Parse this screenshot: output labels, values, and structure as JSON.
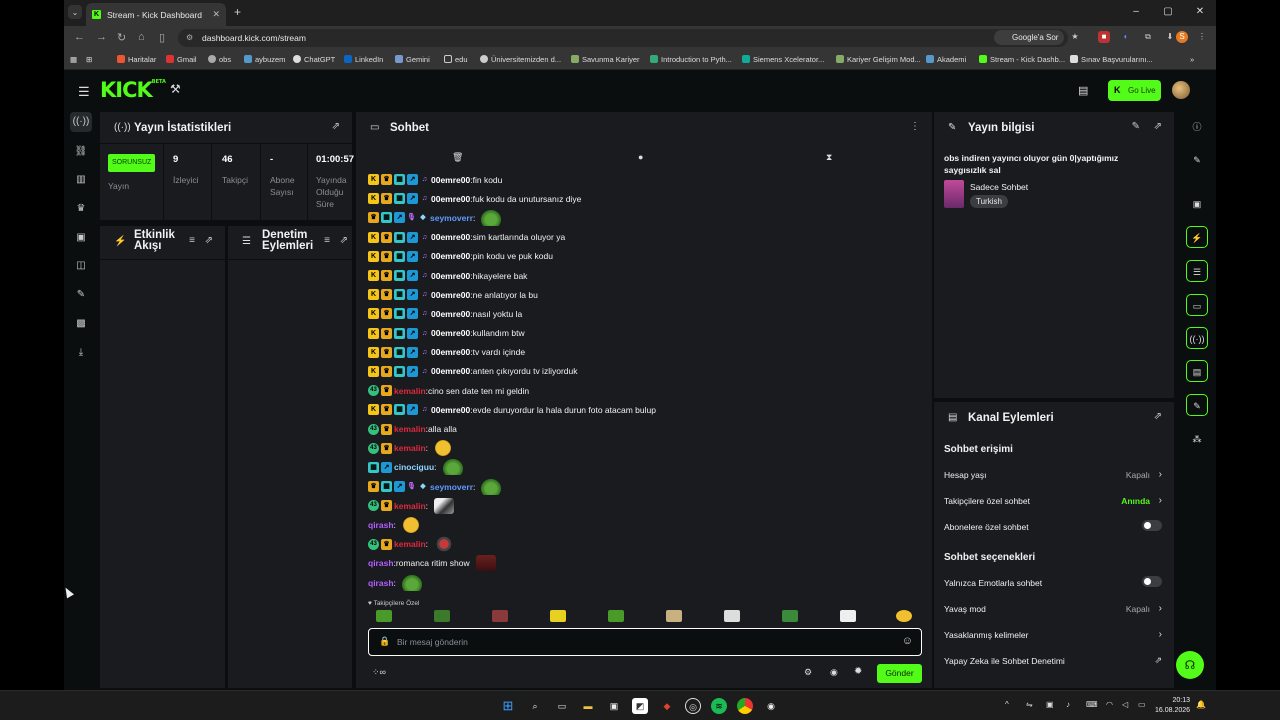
{
  "browser": {
    "tab_title": "Stream - Kick Dashboard",
    "url": "dashboard.kick.com/stream",
    "google_btn": "Google'a Sor",
    "bookmarks": [
      "Haritalar",
      "Gmail",
      "obs",
      "aybuzem",
      "ChatGPT",
      "LinkedIn",
      "Gemini",
      "edu",
      "Üniversitemizden d...",
      "Savunma Kariyer",
      "Introduction to Pyth...",
      "Siemens Xcelerator...",
      "Kariyer Gelişim Mod...",
      "Akademi",
      "Stream - Kick Dashb...",
      "Sınav Başvurularını..."
    ]
  },
  "header": {
    "logo": "KICK",
    "logo_sup": "BETA",
    "go_live": "Go Live"
  },
  "stats": {
    "title": "Yayın İstatistikleri",
    "badge": "SORUNSUZ",
    "badge_label": "Yayın",
    "viewers": "9",
    "viewers_label": "İzleyici",
    "followers": "46",
    "followers_label": "Takipçi",
    "subs": "-",
    "subs_label": "Abone Sayısı",
    "duration": "01:00:57",
    "duration_label": "Yayında Olduğu Süre"
  },
  "activity": {
    "title": "Etkinlik Akışı"
  },
  "moderation": {
    "title": "Denetim Eylemleri"
  },
  "chat": {
    "title": "Sohbet",
    "pinned_label": "Takipçilere Özel",
    "placeholder": "Bir mesaj gönderin",
    "send": "Gönder",
    "messages": [
      {
        "badges": [
          "k",
          "crown",
          "gift",
          "sub",
          "mus"
        ],
        "user": "00emre00",
        "color": "green",
        "text": "fin kodu"
      },
      {
        "badges": [
          "k",
          "crown",
          "gift",
          "sub",
          "mus"
        ],
        "user": "00emre00",
        "color": "green",
        "text": "fuk kodu da unutursanız diye"
      },
      {
        "badges": [
          "crown",
          "gift",
          "sub",
          "mic",
          "gem"
        ],
        "user": "seymoverr",
        "color": "blue",
        "text": "",
        "emote": "frog"
      },
      {
        "badges": [
          "k",
          "crown",
          "gift",
          "sub",
          "mus"
        ],
        "user": "00emre00",
        "color": "green",
        "text": "sim kartlarında oluyor ya"
      },
      {
        "badges": [
          "k",
          "crown",
          "gift",
          "sub",
          "mus"
        ],
        "user": "00emre00",
        "color": "green",
        "text": "pin kodu ve puk kodu"
      },
      {
        "badges": [
          "k",
          "crown",
          "gift",
          "sub",
          "mus"
        ],
        "user": "00emre00",
        "color": "green",
        "text": "hikayelere bak"
      },
      {
        "badges": [
          "k",
          "crown",
          "gift",
          "sub",
          "mus"
        ],
        "user": "00emre00",
        "color": "green",
        "text": "ne anlatıyor la bu"
      },
      {
        "badges": [
          "k",
          "crown",
          "gift",
          "sub",
          "mus"
        ],
        "user": "00emre00",
        "color": "green",
        "text": "nasıl yoktu la"
      },
      {
        "badges": [
          "k",
          "crown",
          "gift",
          "sub",
          "mus"
        ],
        "user": "00emre00",
        "color": "green",
        "text": "kullandım btw"
      },
      {
        "badges": [
          "k",
          "crown",
          "gift",
          "sub",
          "mus"
        ],
        "user": "00emre00",
        "color": "green",
        "text": "tv vardı içinde"
      },
      {
        "badges": [
          "k",
          "crown",
          "gift",
          "sub",
          "mus"
        ],
        "user": "00emre00",
        "color": "green",
        "text": "anten çıkıyordu tv izliyorduk"
      },
      {
        "badges": [
          "num",
          "crown"
        ],
        "user": "kemalin",
        "color": "red",
        "text": "cino sen date ten mi geldin"
      },
      {
        "badges": [
          "k",
          "crown",
          "gift",
          "sub",
          "mus"
        ],
        "user": "00emre00",
        "color": "green",
        "text": "evde duruyordur la hala durun foto atacam bulup"
      },
      {
        "badges": [
          "num",
          "crown"
        ],
        "user": "kemalin",
        "color": "red",
        "text": "alla alla"
      },
      {
        "badges": [
          "num",
          "crown"
        ],
        "user": "kemalin",
        "color": "red",
        "text": "",
        "emote": "smile"
      },
      {
        "badges": [
          "gift",
          "sub"
        ],
        "user": "cinociguu",
        "color": "cyan",
        "text": "",
        "emote": "frog"
      },
      {
        "badges": [
          "crown",
          "gift",
          "sub",
          "mic",
          "gem"
        ],
        "user": "seymoverr",
        "color": "blue",
        "text": "",
        "emote": "frog"
      },
      {
        "badges": [
          "num",
          "crown"
        ],
        "user": "kemalin",
        "color": "red",
        "text": "",
        "emote": "pic"
      },
      {
        "badges": [],
        "user": "qirash",
        "color": "purple",
        "text": "",
        "emote": "smile"
      },
      {
        "badges": [
          "num",
          "crown"
        ],
        "user": "kemalin",
        "color": "red",
        "text": "",
        "emote": "spider"
      },
      {
        "badges": [],
        "user": "qirash",
        "color": "purple",
        "text": "romanca ritim show",
        "emote": "dark"
      },
      {
        "badges": [],
        "user": "qirash",
        "color": "purple",
        "text": "",
        "emote": "frog"
      }
    ]
  },
  "stream_info": {
    "title": "Yayın bilgisi",
    "stream_title": "obs indiren yayıncı oluyor gün 0|yaptığımız saygısızlık sal",
    "category": "Sadece Sohbet",
    "language": "Turkish"
  },
  "channel_actions": {
    "title": "Kanal Eylemleri",
    "chat_access": "Sohbet erişimi",
    "account_age": "Hesap yaşı",
    "account_age_val": "Kapalı",
    "followers_only": "Takipçilere özel sohbet",
    "followers_only_val": "Anında",
    "subs_only": "Abonelere özel sohbet",
    "chat_options": "Sohbet seçenekleri",
    "emotes_only": "Yalnızca Emotlarla sohbet",
    "slow_mode": "Yavaş mod",
    "slow_mode_val": "Kapalı",
    "banned_words": "Yasaklanmış kelimeler",
    "ai_moderation": "Yapay Zeka ile Sohbet Denetimi"
  },
  "taskbar": {
    "time": "20:13",
    "date": "16.08.2026"
  },
  "colors": {
    "accent": "#53fc18",
    "panel": "#191b1f",
    "bg": "#0b0e0f"
  }
}
